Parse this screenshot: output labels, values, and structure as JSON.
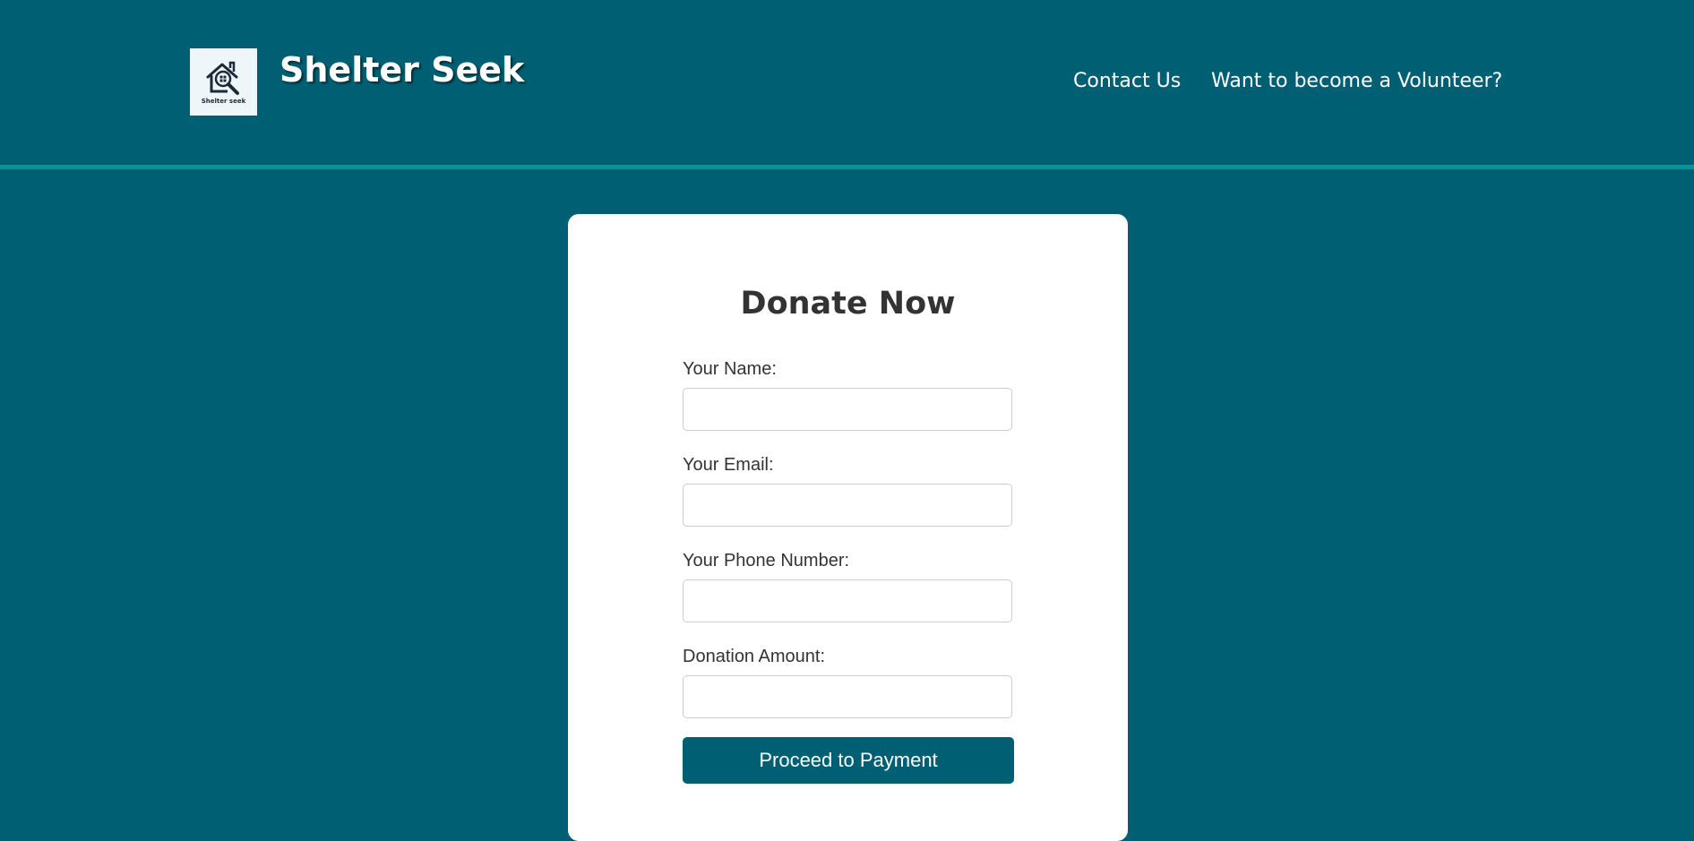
{
  "header": {
    "logo_text": "Shelter seek",
    "brand_title": "Shelter Seek",
    "nav": {
      "contact": "Contact Us",
      "volunteer": "Want to become a Volunteer?"
    }
  },
  "form": {
    "title": "Donate Now",
    "fields": [
      {
        "label": "Your Name:",
        "value": "",
        "placeholder": ""
      },
      {
        "label": "Your Email:",
        "value": "",
        "placeholder": ""
      },
      {
        "label": "Your Phone Number:",
        "value": "",
        "placeholder": ""
      },
      {
        "label": "Donation Amount:",
        "value": "",
        "placeholder": ""
      }
    ],
    "submit_label": "Proceed to Payment"
  },
  "colors": {
    "background": "#005f73",
    "header_divider": "#0a9396",
    "card": "#ffffff",
    "button": "#005f73",
    "text_dark": "#333333"
  },
  "icons": {
    "logo": "house-search-icon"
  }
}
